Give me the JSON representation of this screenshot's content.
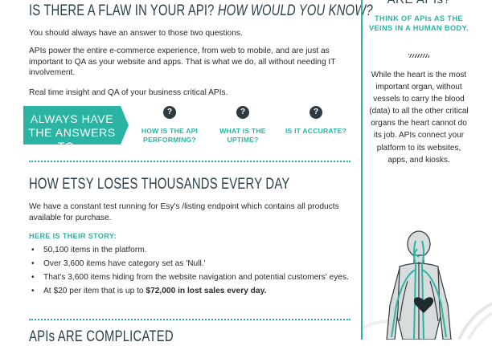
{
  "main": {
    "heading1": {
      "plain": "IS THERE A FLAW IN YOUR API?",
      "italic": "HOW WOULD YOU KNOW?"
    },
    "para1": "You should always have an answer to those two questions.",
    "para2": "APIs power the entire e-commerce experience, from web to mobile, and are just as important to QA as your website and apps. That is what we do, all without needing IT involvement.",
    "para3": "Real time insight and QA of your business critical APIs.",
    "banner": "ALWAYS HAVE THE ANSWERS TO…",
    "questions": [
      {
        "mark": "?",
        "label": "HOW IS THE API PERFORMING?"
      },
      {
        "mark": "?",
        "label": "WHAT IS THE UPTIME?"
      },
      {
        "mark": "?",
        "label": "IS IT ACCURATE?"
      }
    ],
    "heading2": "HOW ETSY LOSES THOUSANDS EVERY DAY",
    "para4": "We have a constant test running for Esy's /listing endpoint which contains all products available for purchase.",
    "story_label": "HERE IS THEIR STORY:",
    "bullets": [
      "50,100 items in the platform.",
      "Over 3,600 items have category set as 'Null.'",
      "That's 3,600 items hiding from the website navigation and potential customers' eyes."
    ],
    "last_bullet": {
      "prefix": "At $20 per item that is up to ",
      "bold": "$72,000 in lost sales every day."
    },
    "heading3": "APIs ARE COMPLICATED"
  },
  "sidebar": {
    "title": "ARE APIs?",
    "subtitle": "THINK OF APIs AS THE VEINS IN A HUMAN BODY.",
    "body": "While the heart is the most important organ, without vessels to carry the blood (data) to all the other critical organs the heart cannot do its job. APIs connect your platform to its websites, apps, and kiosks.",
    "illustration": "human-body-veins-illustration"
  },
  "colors": {
    "accent": "#2bb3a3",
    "heading": "#2d4048",
    "question_circle": "#2d3a40"
  }
}
